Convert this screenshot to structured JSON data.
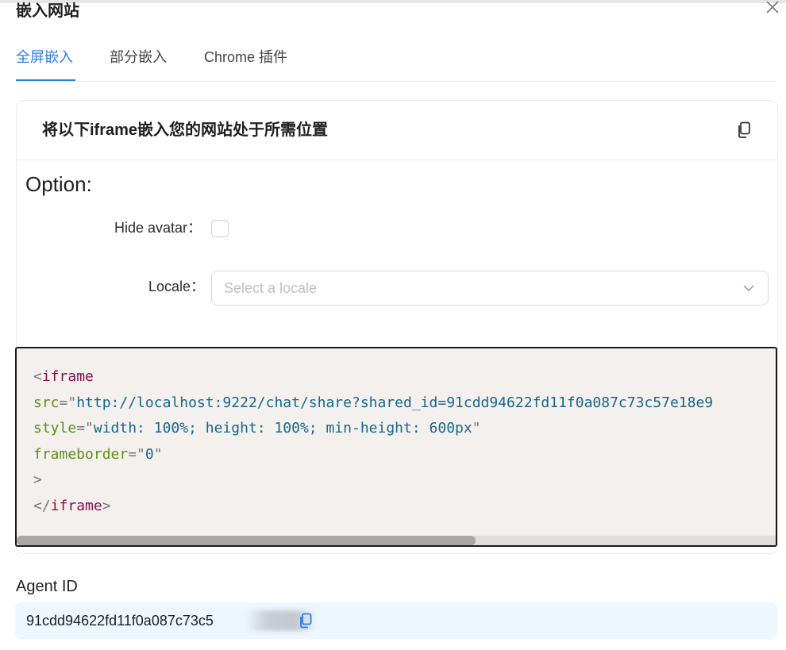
{
  "modal": {
    "title": "嵌入网站",
    "close_icon": "close-icon"
  },
  "tabs": [
    {
      "label": "全屏嵌入",
      "active": true
    },
    {
      "label": "部分嵌入",
      "active": false
    },
    {
      "label": "Chrome 插件",
      "active": false
    }
  ],
  "card": {
    "title": "将以下iframe嵌入您的网站处于所需位置",
    "copy_icon": "copy-icon",
    "option_heading": "Option:",
    "hide_avatar_label": "Hide avatar",
    "hide_avatar_checked": false,
    "locale_label": "Locale",
    "locale_placeholder": "Select a locale"
  },
  "code": {
    "open_bracket": "<",
    "tag": "iframe",
    "attr_src": "src",
    "val_src": "http://localhost:9222/chat/share?shared_id=91cdd94622fd11f0a087c73c57e18e9",
    "attr_style": "style",
    "val_style": "width: 100%; height: 100%; min-height: 600px",
    "attr_frameborder": "frameborder",
    "val_frameborder": "0",
    "close_bracket": ">",
    "end_open": "</",
    "end_tag": "iframe",
    "end_close": ">"
  },
  "agent": {
    "label": "Agent ID",
    "id": "91cdd94622fd11f0a087c73c5",
    "copy_icon": "copy-icon"
  },
  "colors": {
    "accent": "#2b7de9",
    "code_bg": "#f3f0ed",
    "agent_bg": "#eef6ff"
  }
}
